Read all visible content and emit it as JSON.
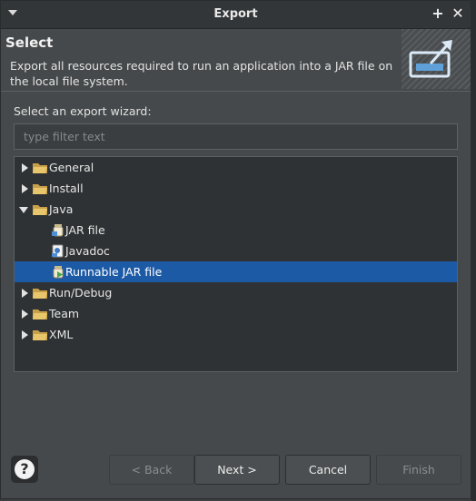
{
  "window": {
    "title": "Export"
  },
  "header": {
    "title": "Select",
    "description": "Export all resources required to run an application into a JAR file on the local file system."
  },
  "wizard_label": "Select an export wizard:",
  "filter": {
    "placeholder": "type filter text",
    "value": ""
  },
  "tree": {
    "items": [
      {
        "label": "General",
        "type": "folder",
        "expanded": false
      },
      {
        "label": "Install",
        "type": "folder",
        "expanded": false
      },
      {
        "label": "Java",
        "type": "folder",
        "expanded": true
      },
      {
        "label": "JAR file",
        "type": "wizard",
        "icon": "jar-icon"
      },
      {
        "label": "Javadoc",
        "type": "wizard",
        "icon": "javadoc-icon"
      },
      {
        "label": "Runnable JAR file",
        "type": "wizard",
        "icon": "runnable-jar-icon",
        "selected": true
      },
      {
        "label": "Run/Debug",
        "type": "folder",
        "expanded": false
      },
      {
        "label": "Team",
        "type": "folder",
        "expanded": false
      },
      {
        "label": "XML",
        "type": "folder",
        "expanded": false
      }
    ]
  },
  "buttons": {
    "help": "?",
    "back": "< Back",
    "next": "Next >",
    "cancel": "Cancel",
    "finish": "Finish"
  },
  "colors": {
    "selection": "#1d5aa6",
    "dialog_bg": "#46494b",
    "tree_bg": "#2f3234"
  }
}
